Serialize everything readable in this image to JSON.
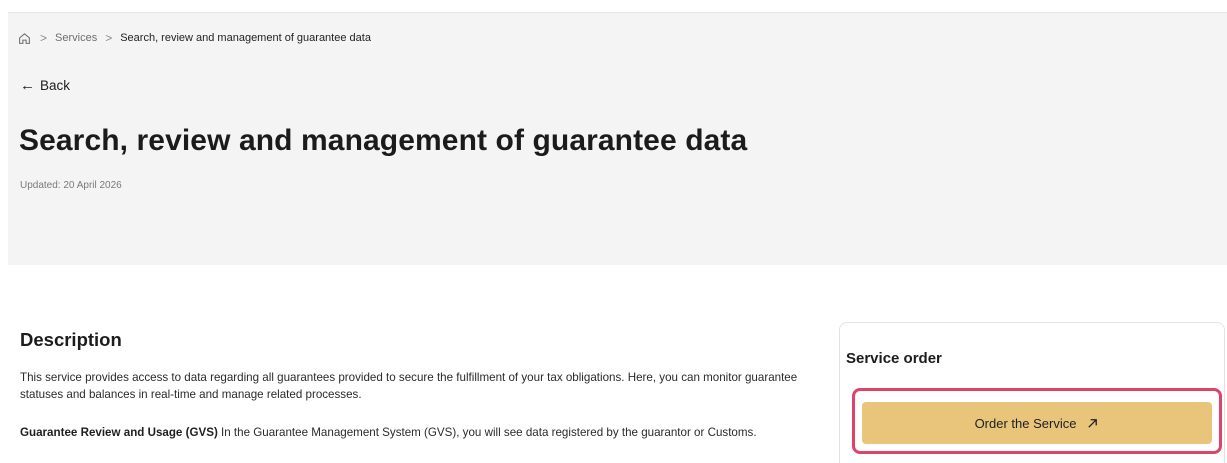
{
  "breadcrumb": {
    "home_icon": "home-icon",
    "separator": ">",
    "services": "Services",
    "current": "Search, review and management of guarantee data"
  },
  "back": {
    "icon": "arrow-left-icon",
    "label": "Back"
  },
  "page": {
    "title": "Search, review and management of guarantee data",
    "updated": "Updated: 20 April 2026"
  },
  "description": {
    "heading": "Description",
    "paragraph1": "This service provides access to data regarding all guarantees provided to secure the fulfillment of your tax obligations. Here, you can monitor guarantee statuses and balances in real-time and manage related processes.",
    "paragraph2_bold": "Guarantee Review and Usage (GVS)",
    "paragraph2_rest": " In the Guarantee Management System (GVS), you will see data registered by the guarantor or Customs."
  },
  "service_order": {
    "title": "Service order",
    "button_label": "Order the Service",
    "button_icon": "external-link-arrow-icon"
  },
  "colors": {
    "hero_bg": "#f4f4f4",
    "button_bg": "#e8c57a",
    "highlight_border": "#e0436a"
  }
}
